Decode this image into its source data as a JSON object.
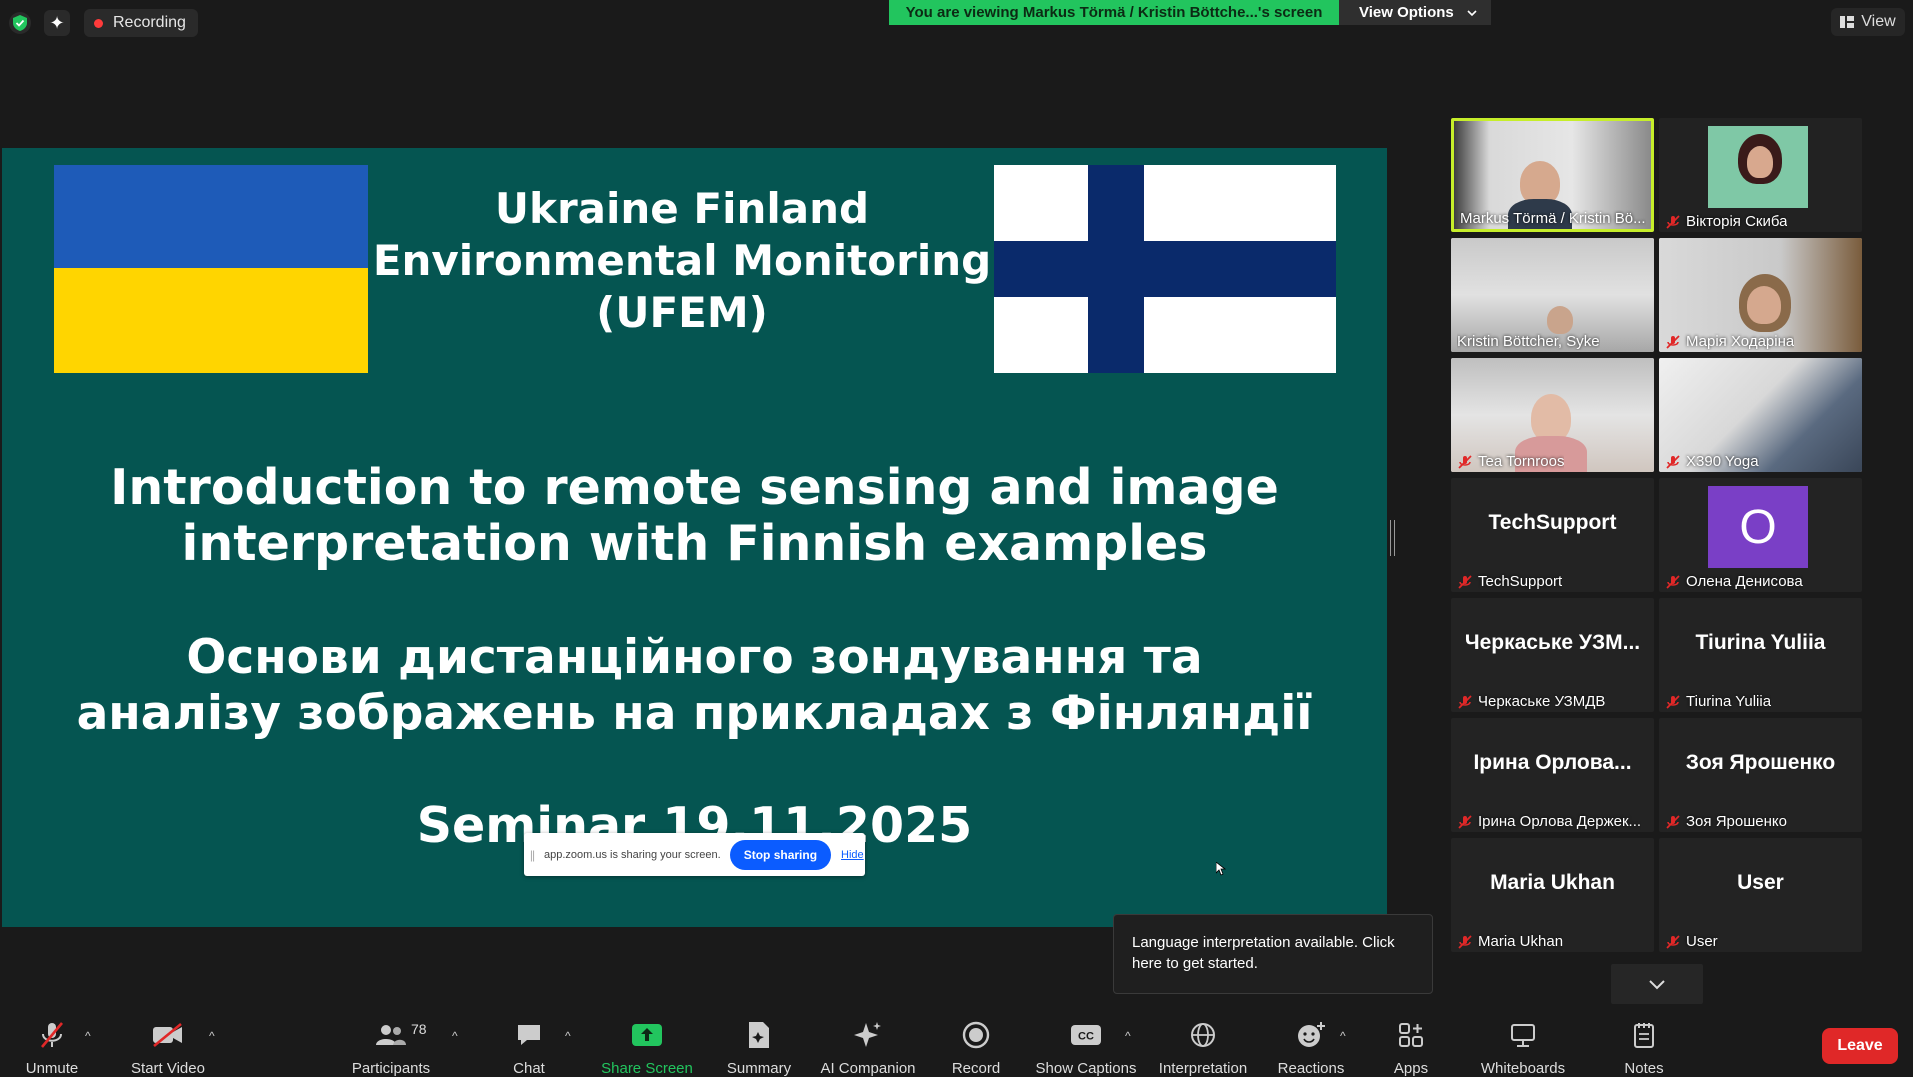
{
  "top": {
    "recording_label": "Recording",
    "viewing_banner": "You are viewing Markus Törmä / Kristin Böttche...'s screen",
    "view_options_label": "View Options",
    "view_label": "View"
  },
  "slide": {
    "title_lines": [
      "Ukraine Finland",
      "Environmental Monitoring",
      "(UFEM)"
    ],
    "english_lines": [
      "Introduction to remote sensing and image",
      "interpretation with Finnish examples"
    ],
    "ukrainian_lines": [
      "Основи дистанційного зондування та",
      "аналізу зображень на прикладах з Фінляндії"
    ],
    "seminar": "Seminar 19.11.2025",
    "colors": {
      "background": "#055551",
      "ua_blue": "#1e5bb8",
      "ua_yellow": "#ffd500",
      "fi_blue": "#0a2a6b"
    }
  },
  "share_bar": {
    "text": "app.zoom.us is sharing your screen.",
    "stop_label": "Stop sharing",
    "hide_label": "Hide"
  },
  "gallery": {
    "tiles": [
      {
        "name": "Markus Törmä / Kristin Bö...",
        "muted": false,
        "active": true,
        "kind": "video"
      },
      {
        "name": "Вікторія Скиба",
        "muted": true,
        "kind": "video"
      },
      {
        "name": "Kristin Böttcher, Syke",
        "muted": false,
        "kind": "video"
      },
      {
        "name": "Марія Ходаріна",
        "muted": true,
        "kind": "video"
      },
      {
        "name": "Tea Tornroos",
        "muted": true,
        "kind": "video"
      },
      {
        "name": "X390 Yoga",
        "muted": true,
        "kind": "video"
      },
      {
        "name": "TechSupport",
        "display": "TechSupport",
        "muted": true,
        "kind": "name"
      },
      {
        "name": "Олена Денисова",
        "initial": "О",
        "muted": true,
        "kind": "avatar"
      },
      {
        "name": "Черкаське УЗМДВ",
        "display": "Черкаське УЗМ...",
        "muted": true,
        "kind": "name"
      },
      {
        "name": "Tiurina Yuliia",
        "display": "Tiurina Yuliia",
        "muted": true,
        "kind": "name"
      },
      {
        "name": "Ірина Орлова Держек...",
        "display": "Ірина Орлова...",
        "muted": true,
        "kind": "name"
      },
      {
        "name": "Зоя Ярошенко",
        "display": "Зоя Ярошенко",
        "muted": true,
        "kind": "name"
      },
      {
        "name": "Maria Ukhan",
        "display": "Maria Ukhan",
        "muted": true,
        "kind": "name"
      },
      {
        "name": "User",
        "display": "User",
        "muted": true,
        "kind": "name"
      }
    ]
  },
  "tooltip": {
    "text": "Language interpretation available. Click here to get started."
  },
  "toolbar": {
    "unmute": "Unmute",
    "start_video": "Start Video",
    "participants": "Participants",
    "participants_count": "78",
    "chat": "Chat",
    "share_screen": "Share Screen",
    "summary": "Summary",
    "ai_companion": "AI Companion",
    "record": "Record",
    "show_captions": "Show Captions",
    "interpretation": "Interpretation",
    "reactions": "Reactions",
    "apps": "Apps",
    "whiteboards": "Whiteboards",
    "notes": "Notes",
    "leave": "Leave"
  }
}
